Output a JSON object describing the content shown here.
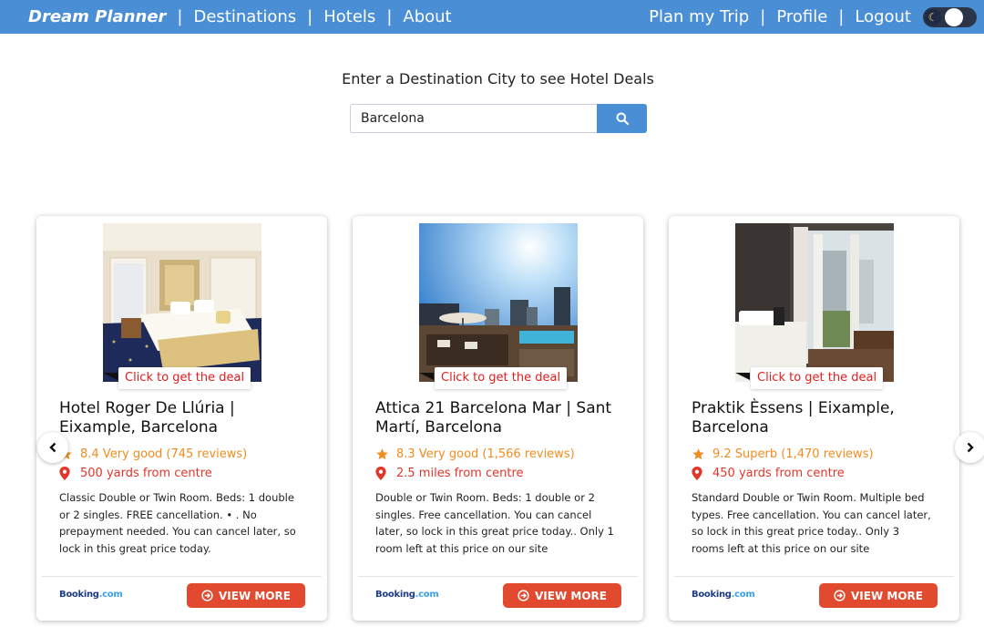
{
  "nav": {
    "brand": "Dream Planner",
    "left_links": [
      "Destinations",
      "Hotels",
      "About"
    ],
    "right_links": [
      "Plan my Trip",
      "Profile",
      "Logout"
    ],
    "separator": "|",
    "theme_toggle_icon": "moon-icon"
  },
  "search": {
    "prompt": "Enter a Destination City to see Hotel Deals",
    "value": "Barcelona",
    "button_icon": "search-icon"
  },
  "colors": {
    "navbar": "#4a8fd6",
    "rating": "#f28c1e",
    "distance": "#e3362a",
    "deal_text": "#e21d1d",
    "view_more": "#e14a2e"
  },
  "cards": [
    {
      "deal_badge": "Click to get the deal",
      "name": "Hotel Roger De Llúria | Eixample, Barcelona",
      "rating": "8.4 Very good (745 reviews)",
      "distance": "500 yards from centre",
      "description": "Classic Double or Twin Room. Beds: 1 double or 2 singles. FREE cancellation. • . No prepayment needed. You can cancel later, so lock in this great price today.",
      "provider": "Booking.com",
      "button": "VIEW MORE"
    },
    {
      "deal_badge": "Click to get the deal",
      "name": "Attica 21 Barcelona Mar | Sant Martí, Barcelona",
      "rating": "8.3 Very good (1,566 reviews)",
      "distance": "2.5 miles from centre",
      "description": "Double or Twin Room. Beds: 1 double or 2 singles. Free cancellation. You can cancel later, so lock in this great price today.. Only 1 room left at this price on our site",
      "provider": "Booking.com",
      "button": "VIEW MORE"
    },
    {
      "deal_badge": "Click to get the deal",
      "name": "Praktik Èssens | Eixample, Barcelona",
      "rating": "9.2 Superb (1,470 reviews)",
      "distance": "450 yards from centre",
      "description": "Standard Double or Twin Room. Multiple bed types. Free cancellation. You can cancel later, so lock in this great price today.. Only 3 rooms left at this price on our site",
      "provider": "Booking.com",
      "button": "VIEW MORE"
    }
  ]
}
